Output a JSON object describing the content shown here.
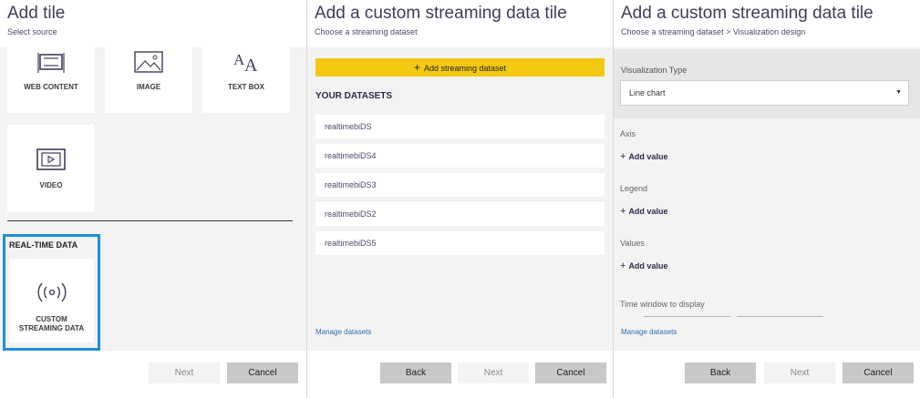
{
  "panel1": {
    "title": "Add tile",
    "subtitle": "Select source",
    "tiles": [
      {
        "label": "WEB CONTENT",
        "icon": "web-content-icon"
      },
      {
        "label": "IMAGE",
        "icon": "image-icon"
      },
      {
        "label": "TEXT BOX",
        "icon": "text-box-icon"
      },
      {
        "label": "VIDEO",
        "icon": "video-icon"
      }
    ],
    "realtime_section": "REAL-TIME DATA",
    "realtime_tile_line1": "CUSTOM",
    "realtime_tile_line2": "STREAMING DATA",
    "next_label": "Next",
    "cancel_label": "Cancel"
  },
  "panel2": {
    "title": "Add a custom streaming data tile",
    "subtitle": "Choose a streaming dataset",
    "add_dataset_label": "Add streaming dataset",
    "datasets_heading": "YOUR DATASETS",
    "datasets": [
      "realtimebiDS",
      "realtimebiDS4",
      "realtimebiDS3",
      "realtimebiDS2",
      "realtimebiDS5"
    ],
    "manage_link": "Manage datasets",
    "back_label": "Back",
    "next_label": "Next",
    "cancel_label": "Cancel"
  },
  "panel3": {
    "title": "Add a custom streaming data tile",
    "subtitle": "Choose a streaming dataset > Visualization design",
    "viz_type_label": "Visualization Type",
    "viz_type_value": "Line chart",
    "axis_label": "Axis",
    "legend_label": "Legend",
    "values_label": "Values",
    "add_value_label": "Add value",
    "time_window_label": "Time window to display",
    "manage_link": "Manage datasets",
    "back_label": "Back",
    "next_label": "Next",
    "cancel_label": "Cancel"
  },
  "colors": {
    "accent_yellow": "#f2c811",
    "selection_blue": "#1e8fdc",
    "title_color": "#3d3d5c",
    "link_blue": "#2e6fb5"
  }
}
